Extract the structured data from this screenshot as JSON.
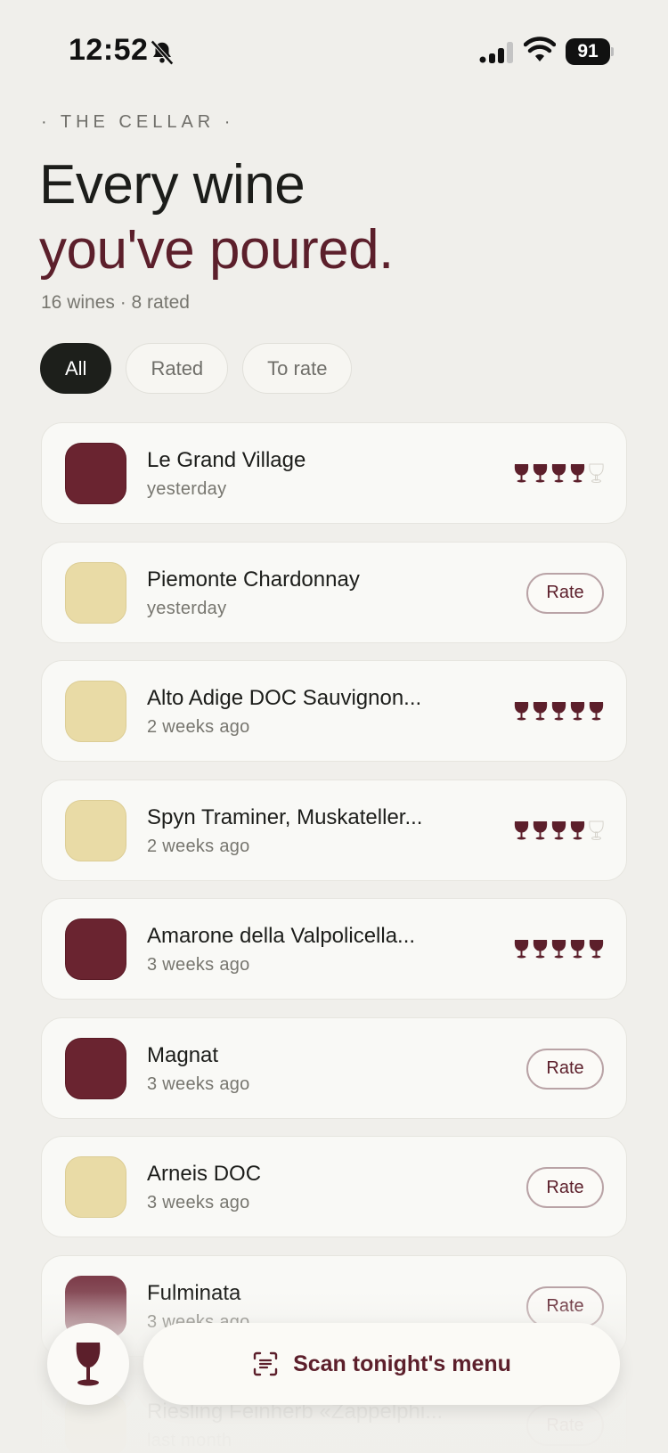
{
  "status_bar": {
    "time": "12:52",
    "battery": "91"
  },
  "header": {
    "eyebrow": "· THE CELLAR ·",
    "title_line1": "Every wine",
    "title_line2": "you've poured.",
    "counts": "16 wines · 8 rated"
  },
  "filters": [
    {
      "label": "All",
      "active": true
    },
    {
      "label": "Rated",
      "active": false
    },
    {
      "label": "To rate",
      "active": false
    }
  ],
  "rate_label": "Rate",
  "wines": [
    {
      "name": "Le Grand Village",
      "date": "yesterday",
      "color": "red",
      "rating": 4
    },
    {
      "name": "Piemonte Chardonnay",
      "date": "yesterday",
      "color": "white",
      "rating": null
    },
    {
      "name": "Alto Adige DOC Sauvignon...",
      "date": "2 weeks ago",
      "color": "white",
      "rating": 5
    },
    {
      "name": "Spyn Traminer, Muskateller...",
      "date": "2 weeks ago",
      "color": "white",
      "rating": 4
    },
    {
      "name": "Amarone della Valpolicella...",
      "date": "3 weeks ago",
      "color": "red",
      "rating": 5
    },
    {
      "name": "Magnat",
      "date": "3 weeks ago",
      "color": "red",
      "rating": null
    },
    {
      "name": "Arneis DOC",
      "date": "3 weeks ago",
      "color": "white",
      "rating": null
    },
    {
      "name": "Fulminata",
      "date": "3 weeks ago",
      "color": "rose",
      "rating": null
    },
    {
      "name": "Riesling Feinherb «Zappelphi...",
      "date": "last month",
      "color": "white",
      "rating": null
    }
  ],
  "scan_button": {
    "label": "Scan tonight's menu",
    "icon": "scan-icon"
  },
  "colors": {
    "accent": "#5c1f2b",
    "red_wine": "#6a2430",
    "white_wine": "#e9dba6",
    "background": "#f0efeb"
  }
}
